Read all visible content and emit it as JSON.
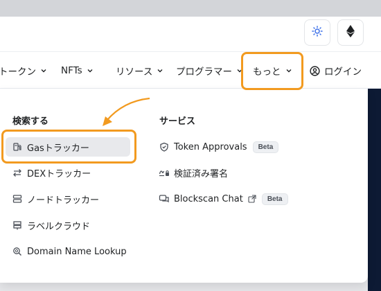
{
  "topbar": {
    "theme_icon": "sun-icon",
    "network_icon": "ethereum-icon"
  },
  "nav": {
    "items": [
      {
        "label": "トークン"
      },
      {
        "label": "NFTs"
      },
      {
        "label": "リソース"
      },
      {
        "label": "プログラマー"
      },
      {
        "label": "もっと"
      }
    ],
    "login_label": "ログイン"
  },
  "dropdown": {
    "search_heading": "検索する",
    "search_items": [
      {
        "label": "Gasトラッカー",
        "icon": "gas-pump-icon",
        "active": true
      },
      {
        "label": "DEXトラッカー",
        "icon": "swap-arrows-icon"
      },
      {
        "label": "ノードトラッカー",
        "icon": "server-icon"
      },
      {
        "label": "ラベルクラウド",
        "icon": "signpost-icon"
      },
      {
        "label": "Domain Name Lookup",
        "icon": "search-globe-icon"
      }
    ],
    "services_heading": "サービス",
    "services_items": [
      {
        "label": "Token Approvals",
        "icon": "shield-icon",
        "badge": "Beta"
      },
      {
        "label": "検証済み署名",
        "icon": "signature-icon"
      },
      {
        "label": "Blockscan Chat",
        "icon": "chat-icon",
        "badge": "Beta"
      }
    ]
  },
  "colors": {
    "highlight": "#f29a1f",
    "dark_strip": "#0d1a34"
  }
}
